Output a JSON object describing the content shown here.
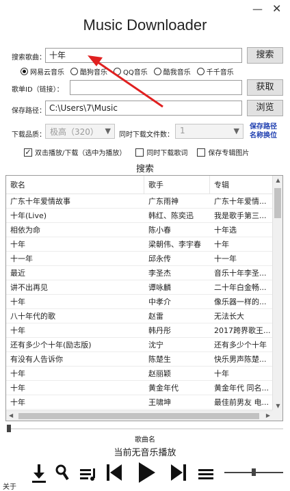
{
  "window": {
    "title": "Music Downloader",
    "minimize_glyph": "—",
    "close_glyph": "✕"
  },
  "search": {
    "label": "搜索歌曲：",
    "value": "十年",
    "button": "搜索"
  },
  "sources": [
    {
      "label": "网易云音乐",
      "selected": true
    },
    {
      "label": "酷狗音乐",
      "selected": false
    },
    {
      "label": "QQ音乐",
      "selected": false
    },
    {
      "label": "酷我音乐",
      "selected": false
    },
    {
      "label": "千千音乐",
      "selected": false
    }
  ],
  "playlist_id": {
    "label": "歌单ID（链接）：",
    "value": "",
    "button": "获取"
  },
  "save_path": {
    "label": "保存路径：",
    "value": "C:\\Users\\7\\Music",
    "button": "浏览"
  },
  "download_quality": {
    "label": "下载品质：",
    "selected": "极高（320）"
  },
  "concurrent_downloads": {
    "label": "同时下载文件数：",
    "selected": "1"
  },
  "links": {
    "save_path_line1": "保存路径",
    "save_path_line2": "名称换位"
  },
  "options": [
    {
      "label": "双击播放/下载（选中为播放）",
      "checked": true
    },
    {
      "label": "同时下载歌词",
      "checked": false
    },
    {
      "label": "保存专辑图片",
      "checked": false
    }
  ],
  "results": {
    "title": "搜索",
    "columns": [
      "歌名",
      "歌手",
      "专辑"
    ],
    "rows": [
      [
        "广东十年爱情故事",
        "广东雨神",
        "广东十年爱情..."
      ],
      [
        "十年(Live)",
        "韩红、陈奕迅",
        "我是歌手第三..."
      ],
      [
        "相依为命",
        "陈小春",
        "十年选"
      ],
      [
        "十年",
        "梁朝伟、李宇春",
        "十年"
      ],
      [
        "十一年",
        "邱永传",
        "十一年"
      ],
      [
        "最近",
        "李圣杰",
        "音乐十年李圣..."
      ],
      [
        "讲不出再见",
        "谭咏麟",
        "二十年白金畅..."
      ],
      [
        "十年",
        "中孝介",
        "像乐器一样的..."
      ],
      [
        "八十年代的歌",
        "赵雷",
        "无法长大"
      ],
      [
        "十年",
        "韩丹彤",
        "2017跨界歌王..."
      ],
      [
        "还有多少个十年(励志版)",
        "沈宁",
        "还有多少个十年"
      ],
      [
        "有没有人告诉你",
        "陈楚生",
        "快乐男声陈楚..."
      ],
      [
        "十年",
        "赵丽颖",
        "十年"
      ],
      [
        "十年",
        "黄金年代",
        "黄金年代 同名..."
      ],
      [
        "十年",
        "王啸坤",
        "最佳前男友 电..."
      ]
    ]
  },
  "player": {
    "song_label": "歌曲名",
    "status": "当前无音乐播放",
    "about": "关于"
  },
  "colors": {
    "accent_link": "#1f3fb0",
    "annotation_arrow": "#e02020"
  }
}
